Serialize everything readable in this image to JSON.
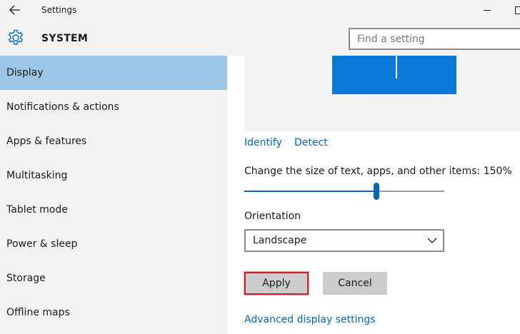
{
  "window": {
    "title": "Settings"
  },
  "header": {
    "section_title": "SYSTEM",
    "search_placeholder": "Find a setting"
  },
  "sidebar": {
    "items": [
      {
        "label": "Display",
        "active": true
      },
      {
        "label": "Notifications & actions",
        "active": false
      },
      {
        "label": "Apps & features",
        "active": false
      },
      {
        "label": "Multitasking",
        "active": false
      },
      {
        "label": "Tablet mode",
        "active": false
      },
      {
        "label": "Power & sleep",
        "active": false
      },
      {
        "label": "Storage",
        "active": false
      },
      {
        "label": "Offline maps",
        "active": false
      }
    ]
  },
  "display": {
    "identify_label": "Identify",
    "detect_label": "Detect",
    "scale_label": "Change the size of text, apps, and other items: 150%",
    "scale_slider_fraction": 0.66,
    "orientation_label": "Orientation",
    "orientation_value": "Landscape",
    "apply_label": "Apply",
    "cancel_label": "Cancel",
    "advanced_label": "Advanced display settings"
  },
  "colors": {
    "accent": "#0067b8",
    "monitor": "#0a78d7",
    "active_nav": "#9cc5e6",
    "apply_highlight": "#c0272d"
  },
  "icons": {
    "back": "back-arrow-icon",
    "gear": "gear-icon",
    "chevron": "chevron-down-icon"
  }
}
